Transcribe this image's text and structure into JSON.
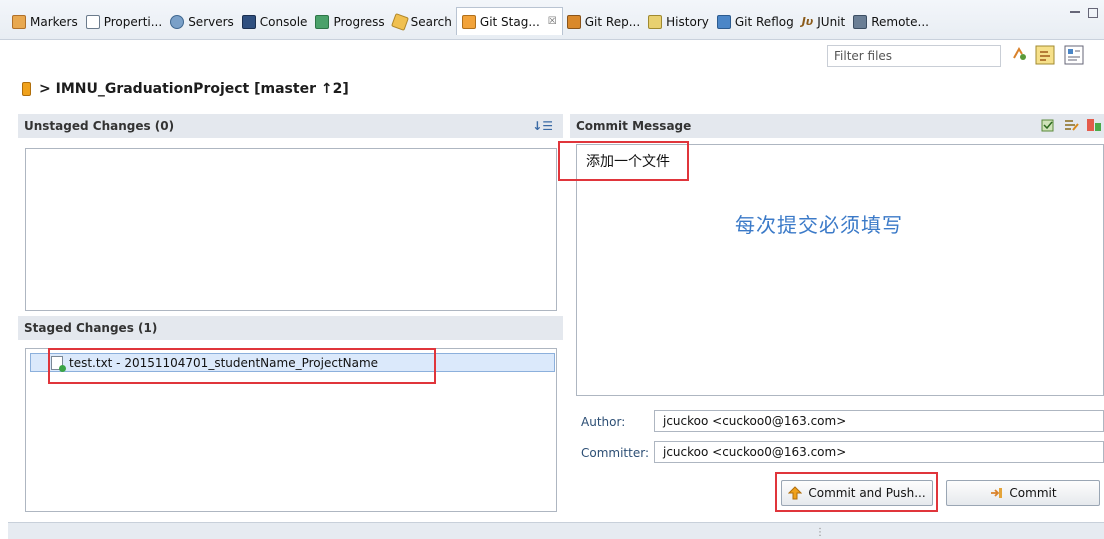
{
  "tabs": [
    {
      "label": "Markers",
      "icon": "markers-icon"
    },
    {
      "label": "Properti...",
      "icon": "properties-icon"
    },
    {
      "label": "Servers",
      "icon": "servers-icon"
    },
    {
      "label": "Console",
      "icon": "console-icon"
    },
    {
      "label": "Progress",
      "icon": "progress-icon"
    },
    {
      "label": "Search",
      "icon": "search-icon"
    },
    {
      "label": "Git Stag...",
      "icon": "git-staging-icon",
      "active": true,
      "close": "☒"
    },
    {
      "label": "Git Rep...",
      "icon": "git-repositories-icon"
    },
    {
      "label": "History",
      "icon": "history-icon"
    },
    {
      "label": "Git Reflog",
      "icon": "git-reflog-icon"
    },
    {
      "label": "JUnit",
      "icon": "junit-icon",
      "glyph": "Jυ"
    },
    {
      "label": "Remote...",
      "icon": "remote-icon"
    }
  ],
  "filter": {
    "placeholder": "Filter files"
  },
  "repository": {
    "label": "> IMNU_GraduationProject [master ↑2]"
  },
  "unstaged": {
    "title": "Unstaged Changes (0)",
    "items": []
  },
  "staged": {
    "title": "Staged Changes (1)",
    "items": [
      {
        "label": "test.txt - 20151104701_studentName_ProjectName"
      }
    ]
  },
  "commit": {
    "title": "Commit Message",
    "message": "添加一个文件",
    "hint": "每次提交必须填写",
    "author_label": "Author:",
    "author": "jcuckoo <cuckoo0@163.com>",
    "committer_label": "Committer:",
    "committer": "jcuckoo <cuckoo0@163.com>",
    "commit_push_label": "Commit and Push...",
    "commit_label": "Commit"
  },
  "colors": {
    "highlight": "#e0353b",
    "hint": "#3b7ac8",
    "selection": "#dbe9fb"
  }
}
